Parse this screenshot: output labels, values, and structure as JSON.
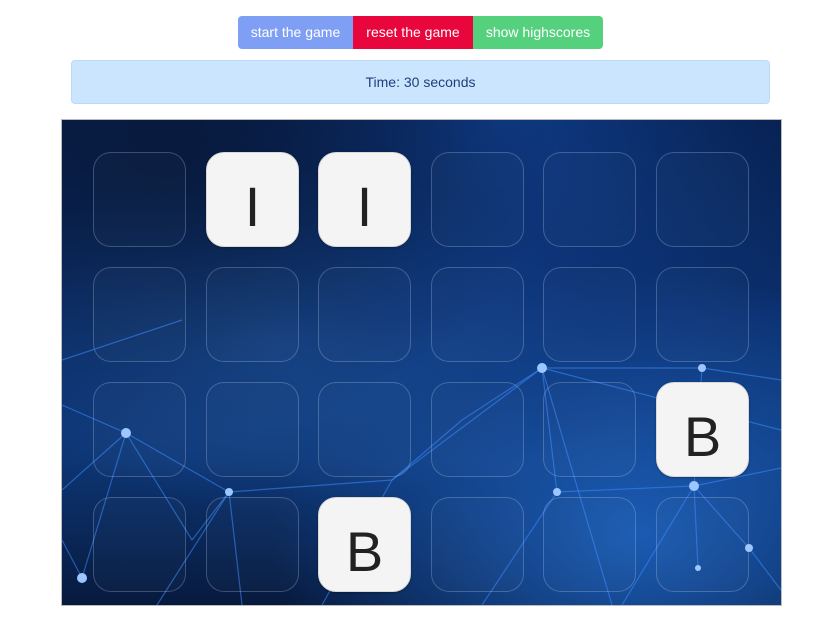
{
  "toolbar": {
    "start_label": "start the game",
    "reset_label": "reset the game",
    "highscores_label": "show highscores"
  },
  "timer": {
    "text": "Time: 30 seconds"
  },
  "board": {
    "rows": 4,
    "cols": 6,
    "tiles": [
      {
        "face": ""
      },
      {
        "face": "I"
      },
      {
        "face": "I"
      },
      {
        "face": ""
      },
      {
        "face": ""
      },
      {
        "face": ""
      },
      {
        "face": ""
      },
      {
        "face": ""
      },
      {
        "face": ""
      },
      {
        "face": ""
      },
      {
        "face": ""
      },
      {
        "face": ""
      },
      {
        "face": ""
      },
      {
        "face": ""
      },
      {
        "face": ""
      },
      {
        "face": ""
      },
      {
        "face": ""
      },
      {
        "face": "B"
      },
      {
        "face": ""
      },
      {
        "face": ""
      },
      {
        "face": "B"
      },
      {
        "face": ""
      },
      {
        "face": ""
      },
      {
        "face": ""
      }
    ]
  },
  "colors": {
    "start_button": "#7f9ff5",
    "reset_button": "#e8063c",
    "highscores_button": "#55d17e",
    "timer_background": "#cce5ff",
    "open_tile": "#f4f4f4"
  }
}
